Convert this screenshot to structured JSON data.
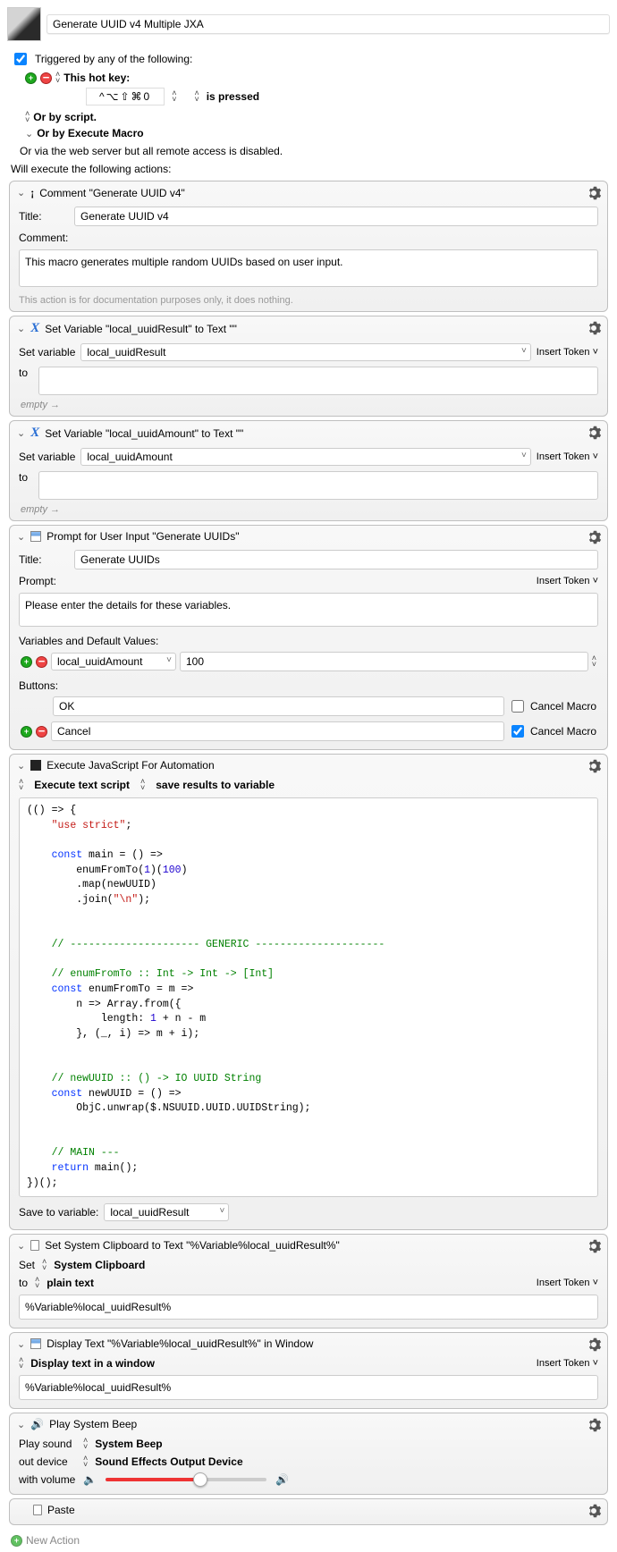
{
  "macroTitle": "Generate UUID v4 Multiple JXA",
  "triggeredLabel": "Triggered by any of the following:",
  "hotkeyLabel": "This hot key:",
  "hotkeyValue": "^\\u2325\\u21e7\\u23180",
  "hotkeySuffix": "is pressed",
  "orByScript": "Or by script.",
  "orByExecMacro": "Or by Execute Macro",
  "orViaWeb": "Or via the web server but all remote access is disabled.",
  "willExecute": "Will execute the following actions:",
  "comment": {
    "header": "Comment \"Generate UUID v4\"",
    "titleLabel": "Title:",
    "titleValue": "Generate UUID v4",
    "commentLabel": "Comment:",
    "commentValue": "This macro generates multiple random UUIDs based on user input.",
    "note": "This action is for documentation purposes only, it does nothing."
  },
  "setVar1": {
    "header": "Set Variable \"local_uuidResult\" to Text \"\"",
    "setLabel": "Set variable",
    "varName": "local_uuidResult",
    "insertToken": "Insert Token",
    "toLabel": "to",
    "empty": "empty →"
  },
  "setVar2": {
    "header": "Set Variable \"local_uuidAmount\" to Text \"\"",
    "setLabel": "Set variable",
    "varName": "local_uuidAmount",
    "insertToken": "Insert Token",
    "toLabel": "to",
    "empty": "empty →"
  },
  "prompt": {
    "header": "Prompt for User Input \"Generate UUIDs\"",
    "titleLabel": "Title:",
    "titleValue": "Generate UUIDs",
    "promptLabel": "Prompt:",
    "insertToken": "Insert Token",
    "promptValue": "Please enter the details for these variables.",
    "varsLabel": "Variables and Default Values:",
    "varName": "local_uuidAmount",
    "varDefault": "100",
    "buttonsLabel": "Buttons:",
    "btnOK": "OK",
    "btnCancel": "Cancel",
    "cancelMacroLabel": "Cancel Macro"
  },
  "jxa": {
    "header": "Execute JavaScript For Automation",
    "opt1": "Execute text script",
    "opt2": "save results to variable",
    "saveLabel": "Save to variable:",
    "saveVar": "local_uuidResult"
  },
  "clipboard": {
    "header": "Set System Clipboard to Text \"%Variable%local_uuidResult%\"",
    "setLabel": "Set",
    "sysClip": "System Clipboard",
    "toLabel": "to",
    "plain": "plain text",
    "insertToken": "Insert Token",
    "value": "%Variable%local_uuidResult%"
  },
  "display": {
    "header": "Display Text \"%Variable%local_uuidResult%\" in Window",
    "opt": "Display text in a window",
    "insertToken": "Insert Token",
    "value": "%Variable%local_uuidResult%"
  },
  "beep": {
    "header": "Play System Beep",
    "playLabel": "Play sound",
    "sound": "System Beep",
    "outLabel": "out device",
    "device": "Sound Effects Output Device",
    "volLabel": "with volume"
  },
  "paste": {
    "header": "Paste"
  },
  "newAction": "New Action"
}
